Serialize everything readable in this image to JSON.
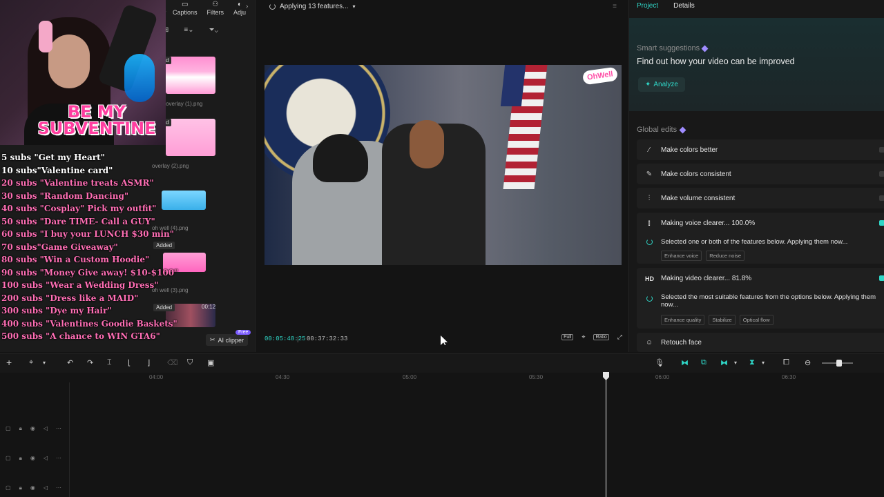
{
  "media_panel": {
    "tabs": [
      {
        "label": "Captions",
        "icon": "captions-icon"
      },
      {
        "label": "Filters",
        "icon": "filters-icon"
      },
      {
        "label": "Adju",
        "icon": "adjust-icon"
      }
    ],
    "partial_tab": "s",
    "thumbnails": [
      {
        "label": "overlay (1).png",
        "added": "d"
      },
      {
        "label": "overlay (2).png",
        "added": "d"
      },
      {
        "label": "oh well (4).png",
        "added": ""
      },
      {
        "label": "oh well (3).png",
        "added": "Added"
      },
      {
        "label": "",
        "added": "Added",
        "duration": "00:12"
      }
    ],
    "ai_clipper": "AI clipper",
    "free_badge": "Free"
  },
  "overlay": {
    "banner_line1": "BE MY",
    "banner_line2": "SUBVENTINE",
    "sub_goals": [
      "5 subs \"Get my Heart\"",
      "10 subs\"Valentine card\"",
      "20 subs \"Valentine treats ASMR\"",
      "30 subs \"Random Dancing\"",
      "40 subs \"Cosplay\" Pick my outfit\"",
      "50 subs \"Dare TIME- Call a GUY\"",
      "60 subs \"I buy your LUNCH $30 min\"",
      "70 subs\"Game Giveaway\"",
      "80 subs \"Win a Custom Hoodie\"",
      "90 subs \"Money Give away! $10-$100\"",
      "100 subs \"Wear a Wedding Dress\"",
      "200 subs \"Dress like a MAID\"",
      "300 subs \"Dye my Hair\"",
      "400 subs \"Valentines Goodie Baskets\"",
      "500 subs \"A chance to WIN GTA6\""
    ]
  },
  "player": {
    "status": "Applying 13 features...",
    "current_time": "00:05:48:25",
    "total_time": "00:37:32:33",
    "controls": [
      "Full",
      "Ratio"
    ],
    "video_logo": "OhWell"
  },
  "right_panel": {
    "tabs": [
      "Project",
      "Details"
    ],
    "active_tab": "Project",
    "smart_suggestions_title": "Smart suggestions",
    "smart_suggestions_headline": "Find out how your video can be improved",
    "analyze_label": "Analyze",
    "global_edits_title": "Global edits",
    "items": [
      {
        "label": "Make colors better",
        "icon": "magic-wand-icon"
      },
      {
        "label": "Make colors consistent",
        "icon": "palette-icon"
      },
      {
        "label": "Make volume consistent",
        "icon": "equalizer-icon"
      }
    ],
    "voice": {
      "label": "Making voice clearer... 100.0%",
      "message": "Selected one or both of the features below. Applying them now...",
      "chips": [
        "Enhance voice",
        "Reduce noise"
      ]
    },
    "video": {
      "badge": "HD",
      "label": "Making video clearer... 81.8%",
      "message": "Selected the most suitable features from the options below. Applying them now...",
      "chips": [
        "Enhance quality",
        "Stabilize",
        "Optical flow"
      ]
    },
    "retouch_label": "Retouch face"
  },
  "timeline": {
    "ticks": [
      "04:00",
      "04:30",
      "05:00",
      "05:30",
      "06:00",
      "06:30"
    ],
    "track_count": 3,
    "zoom_level": 0.5
  },
  "colors": {
    "accent": "#2fd6c7",
    "overlay_pink": "#ff3ea0",
    "gem_purple": "#9f8cff"
  }
}
